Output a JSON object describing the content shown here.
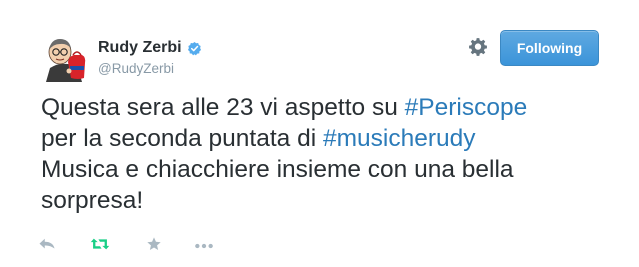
{
  "user": {
    "display_name": "Rudy Zerbi",
    "handle": "@RudyZerbi",
    "verified": true
  },
  "header": {
    "follow_label": "Following"
  },
  "tweet": {
    "segments": [
      {
        "text": "Questa sera alle 23 vi aspetto su ",
        "type": "text"
      },
      {
        "text": "#Periscope",
        "type": "hashtag"
      },
      {
        "text": " per la seconda puntata di ",
        "type": "text"
      },
      {
        "text": "#musicherudy",
        "type": "hashtag"
      },
      {
        "text": " Musica e chiacchiere insieme con una bella sorpresa!",
        "type": "text"
      }
    ]
  },
  "actions": [
    {
      "name": "reply-icon"
    },
    {
      "name": "retweet-icon"
    },
    {
      "name": "favorite-icon"
    },
    {
      "name": "more-icon"
    }
  ],
  "colors": {
    "text": "#292f33",
    "muted": "#8899a6",
    "link": "#2b7bb9",
    "retweet": "#19cf86",
    "button": "#3b94d9",
    "verified": "#55acee"
  }
}
